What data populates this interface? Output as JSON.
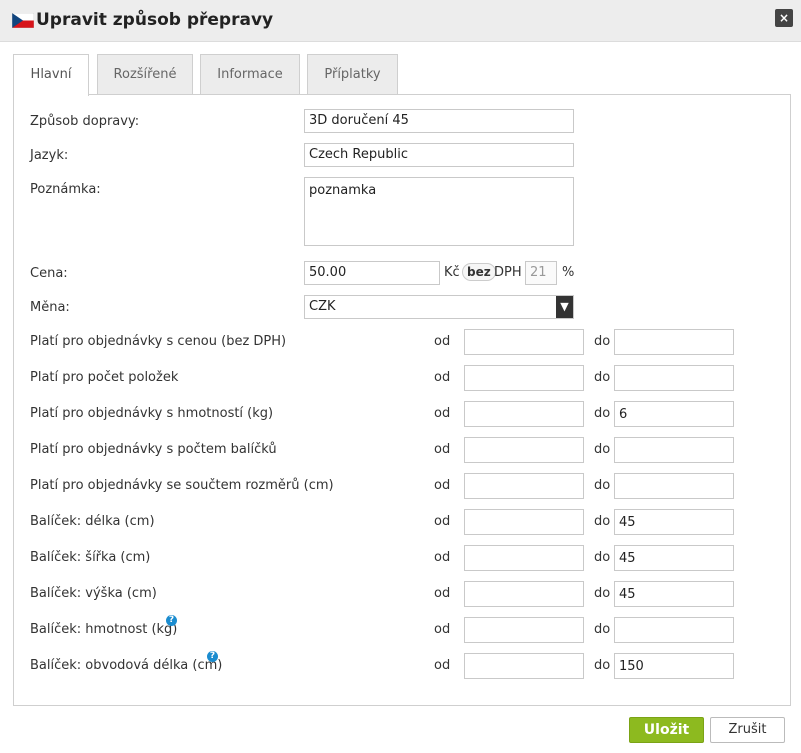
{
  "dialog": {
    "title": "Upravit způsob přepravy",
    "close_label": "×",
    "flag_icon": "czech-flag-icon"
  },
  "tabs": [
    {
      "label": "Hlavní",
      "active": true
    },
    {
      "label": "Rozšířené",
      "active": false
    },
    {
      "label": "Informace",
      "active": false
    },
    {
      "label": "Příplatky",
      "active": false
    }
  ],
  "form": {
    "method": {
      "label": "Způsob dopravy:",
      "value": "3D doručení 45"
    },
    "language": {
      "label": "Jazyk:",
      "value": "Czech Republic"
    },
    "note": {
      "label": "Poznámka:",
      "value": "poznamka"
    },
    "price": {
      "label": "Cena:",
      "value": "50.00",
      "currency_symbol": "Kč",
      "vat_toggle": "bez",
      "vat_label": "DPH",
      "vat_value": "21",
      "percent": "%"
    },
    "currency": {
      "label": "Měna:",
      "value": "CZK"
    }
  },
  "ranges": {
    "from_label": "od",
    "to_label": "do",
    "rows": [
      {
        "label": "Platí pro objednávky s cenou (bez DPH)",
        "from": "",
        "to": "",
        "help": false
      },
      {
        "label": "Platí pro počet položek",
        "from": "",
        "to": "",
        "help": false
      },
      {
        "label": "Platí pro objednávky s hmotností (kg)",
        "from": "",
        "to": "6",
        "help": false
      },
      {
        "label": "Platí pro objednávky s počtem balíčků",
        "from": "",
        "to": "",
        "help": false
      },
      {
        "label": "Platí pro objednávky se součtem rozměrů (cm)",
        "from": "",
        "to": "",
        "help": false
      },
      {
        "label": "Balíček: délka (cm)",
        "from": "",
        "to": "45",
        "help": false
      },
      {
        "label": "Balíček: šířka (cm)",
        "from": "",
        "to": "45",
        "help": false
      },
      {
        "label": "Balíček: výška (cm)",
        "from": "",
        "to": "45",
        "help": false
      },
      {
        "label": "Balíček: hmotnost (kg)",
        "from": "",
        "to": "",
        "help": true
      },
      {
        "label": "Balíček: obvodová délka (cm)",
        "from": "",
        "to": "150",
        "help": true
      }
    ]
  },
  "footer": {
    "save_label": "Uložit",
    "cancel_label": "Zrušit"
  },
  "colors": {
    "save_button": "#8dba1f",
    "help_icon": "#1b8ccf"
  }
}
